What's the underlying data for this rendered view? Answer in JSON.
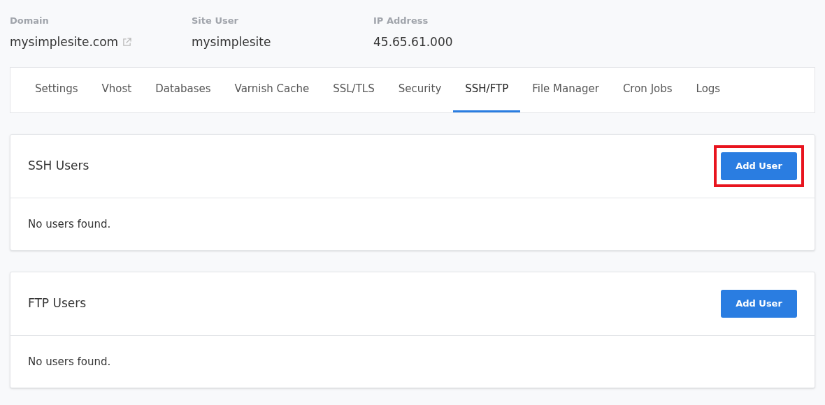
{
  "info": [
    {
      "label": "Domain",
      "value": "mysimplesite.com",
      "external_link": true
    },
    {
      "label": "Site User",
      "value": "mysimplesite",
      "external_link": false
    },
    {
      "label": "IP Address",
      "value": "45.65.61.000",
      "external_link": false
    }
  ],
  "tabs": [
    {
      "label": "Settings",
      "selected": false
    },
    {
      "label": "Vhost",
      "selected": false
    },
    {
      "label": "Databases",
      "selected": false
    },
    {
      "label": "Varnish Cache",
      "selected": false
    },
    {
      "label": "SSL/TLS",
      "selected": false
    },
    {
      "label": "Security",
      "selected": false
    },
    {
      "label": "SSH/FTP",
      "selected": true
    },
    {
      "label": "File Manager",
      "selected": false
    },
    {
      "label": "Cron Jobs",
      "selected": false
    },
    {
      "label": "Logs",
      "selected": false
    }
  ],
  "panels": [
    {
      "title": "SSH Users",
      "button": "Add User",
      "highlighted": true,
      "empty_text": "No users found."
    },
    {
      "title": "FTP Users",
      "button": "Add User",
      "highlighted": false,
      "empty_text": "No users found."
    }
  ]
}
